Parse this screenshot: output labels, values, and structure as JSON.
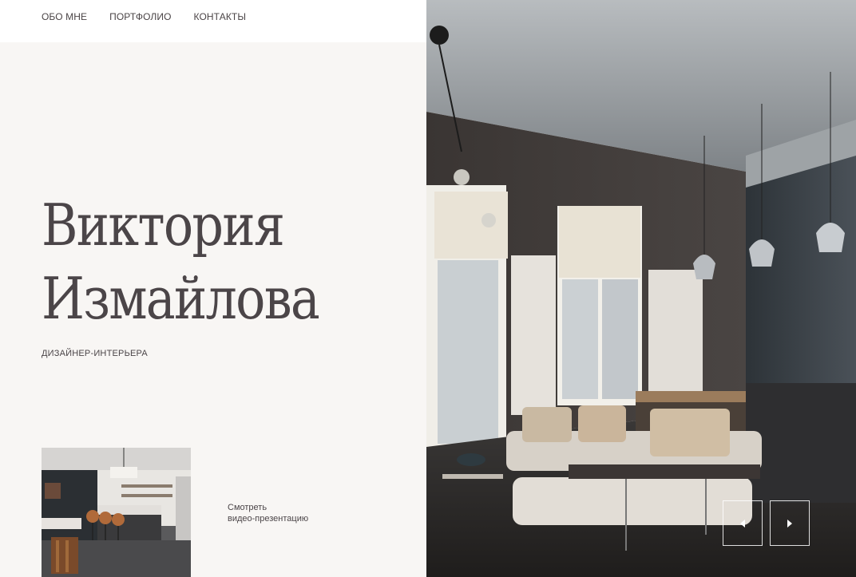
{
  "nav": {
    "items": [
      {
        "label": "ОБО МНЕ"
      },
      {
        "label": "ПОРТФОЛИО"
      },
      {
        "label": "КОНТАКТЫ"
      }
    ]
  },
  "hero": {
    "name_line1": "Виктория",
    "name_line2": "Измайлова",
    "subtitle": "ДИЗАЙНЕР-ИНТЕРЬЕРА"
  },
  "video": {
    "line1": "Смотреть",
    "line2": "видео-презентацию"
  },
  "slider": {
    "prev_icon": "arrow-left-icon",
    "next_icon": "arrow-right-icon"
  },
  "colors": {
    "background": "#f8f6f4",
    "text": "#4b4548",
    "nav_bg": "#ffffff"
  }
}
